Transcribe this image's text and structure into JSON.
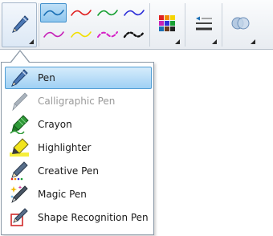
{
  "toolbar": {
    "pen_tool_icon": "pen-icon",
    "line_swatches": [
      {
        "color": "#1a6fb5",
        "style": "solid",
        "selected": true
      },
      {
        "color": "#e02020",
        "style": "solid",
        "selected": false
      },
      {
        "color": "#18a034",
        "style": "solid",
        "selected": false
      },
      {
        "color": "#2d2fd8",
        "style": "solid",
        "selected": false
      },
      {
        "color": "#c623b8",
        "style": "solid",
        "selected": false
      },
      {
        "color": "#f2e000",
        "style": "solid",
        "selected": false
      },
      {
        "color": "#d61fc6",
        "style": "dashed",
        "selected": false
      },
      {
        "color": "#111111",
        "style": "dotted",
        "selected": false
      }
    ],
    "color_palette_icon": "color-palette-icon",
    "line_properties_icon": "line-properties-icon",
    "transparency_icon": "transparency-icon"
  },
  "pen_menu": {
    "items": [
      {
        "label": "Pen",
        "icon": "pen-icon",
        "state": "highlighted"
      },
      {
        "label": "Calligraphic Pen",
        "icon": "calligraphic-pen-icon",
        "state": "disabled"
      },
      {
        "label": "Crayon",
        "icon": "crayon-icon",
        "state": "normal"
      },
      {
        "label": "Highlighter",
        "icon": "highlighter-icon",
        "state": "normal"
      },
      {
        "label": "Creative Pen",
        "icon": "creative-pen-icon",
        "state": "normal"
      },
      {
        "label": "Magic Pen",
        "icon": "magic-pen-icon",
        "state": "normal"
      },
      {
        "label": "Shape Recognition Pen",
        "icon": "shape-recognition-pen-icon",
        "state": "normal"
      }
    ]
  }
}
